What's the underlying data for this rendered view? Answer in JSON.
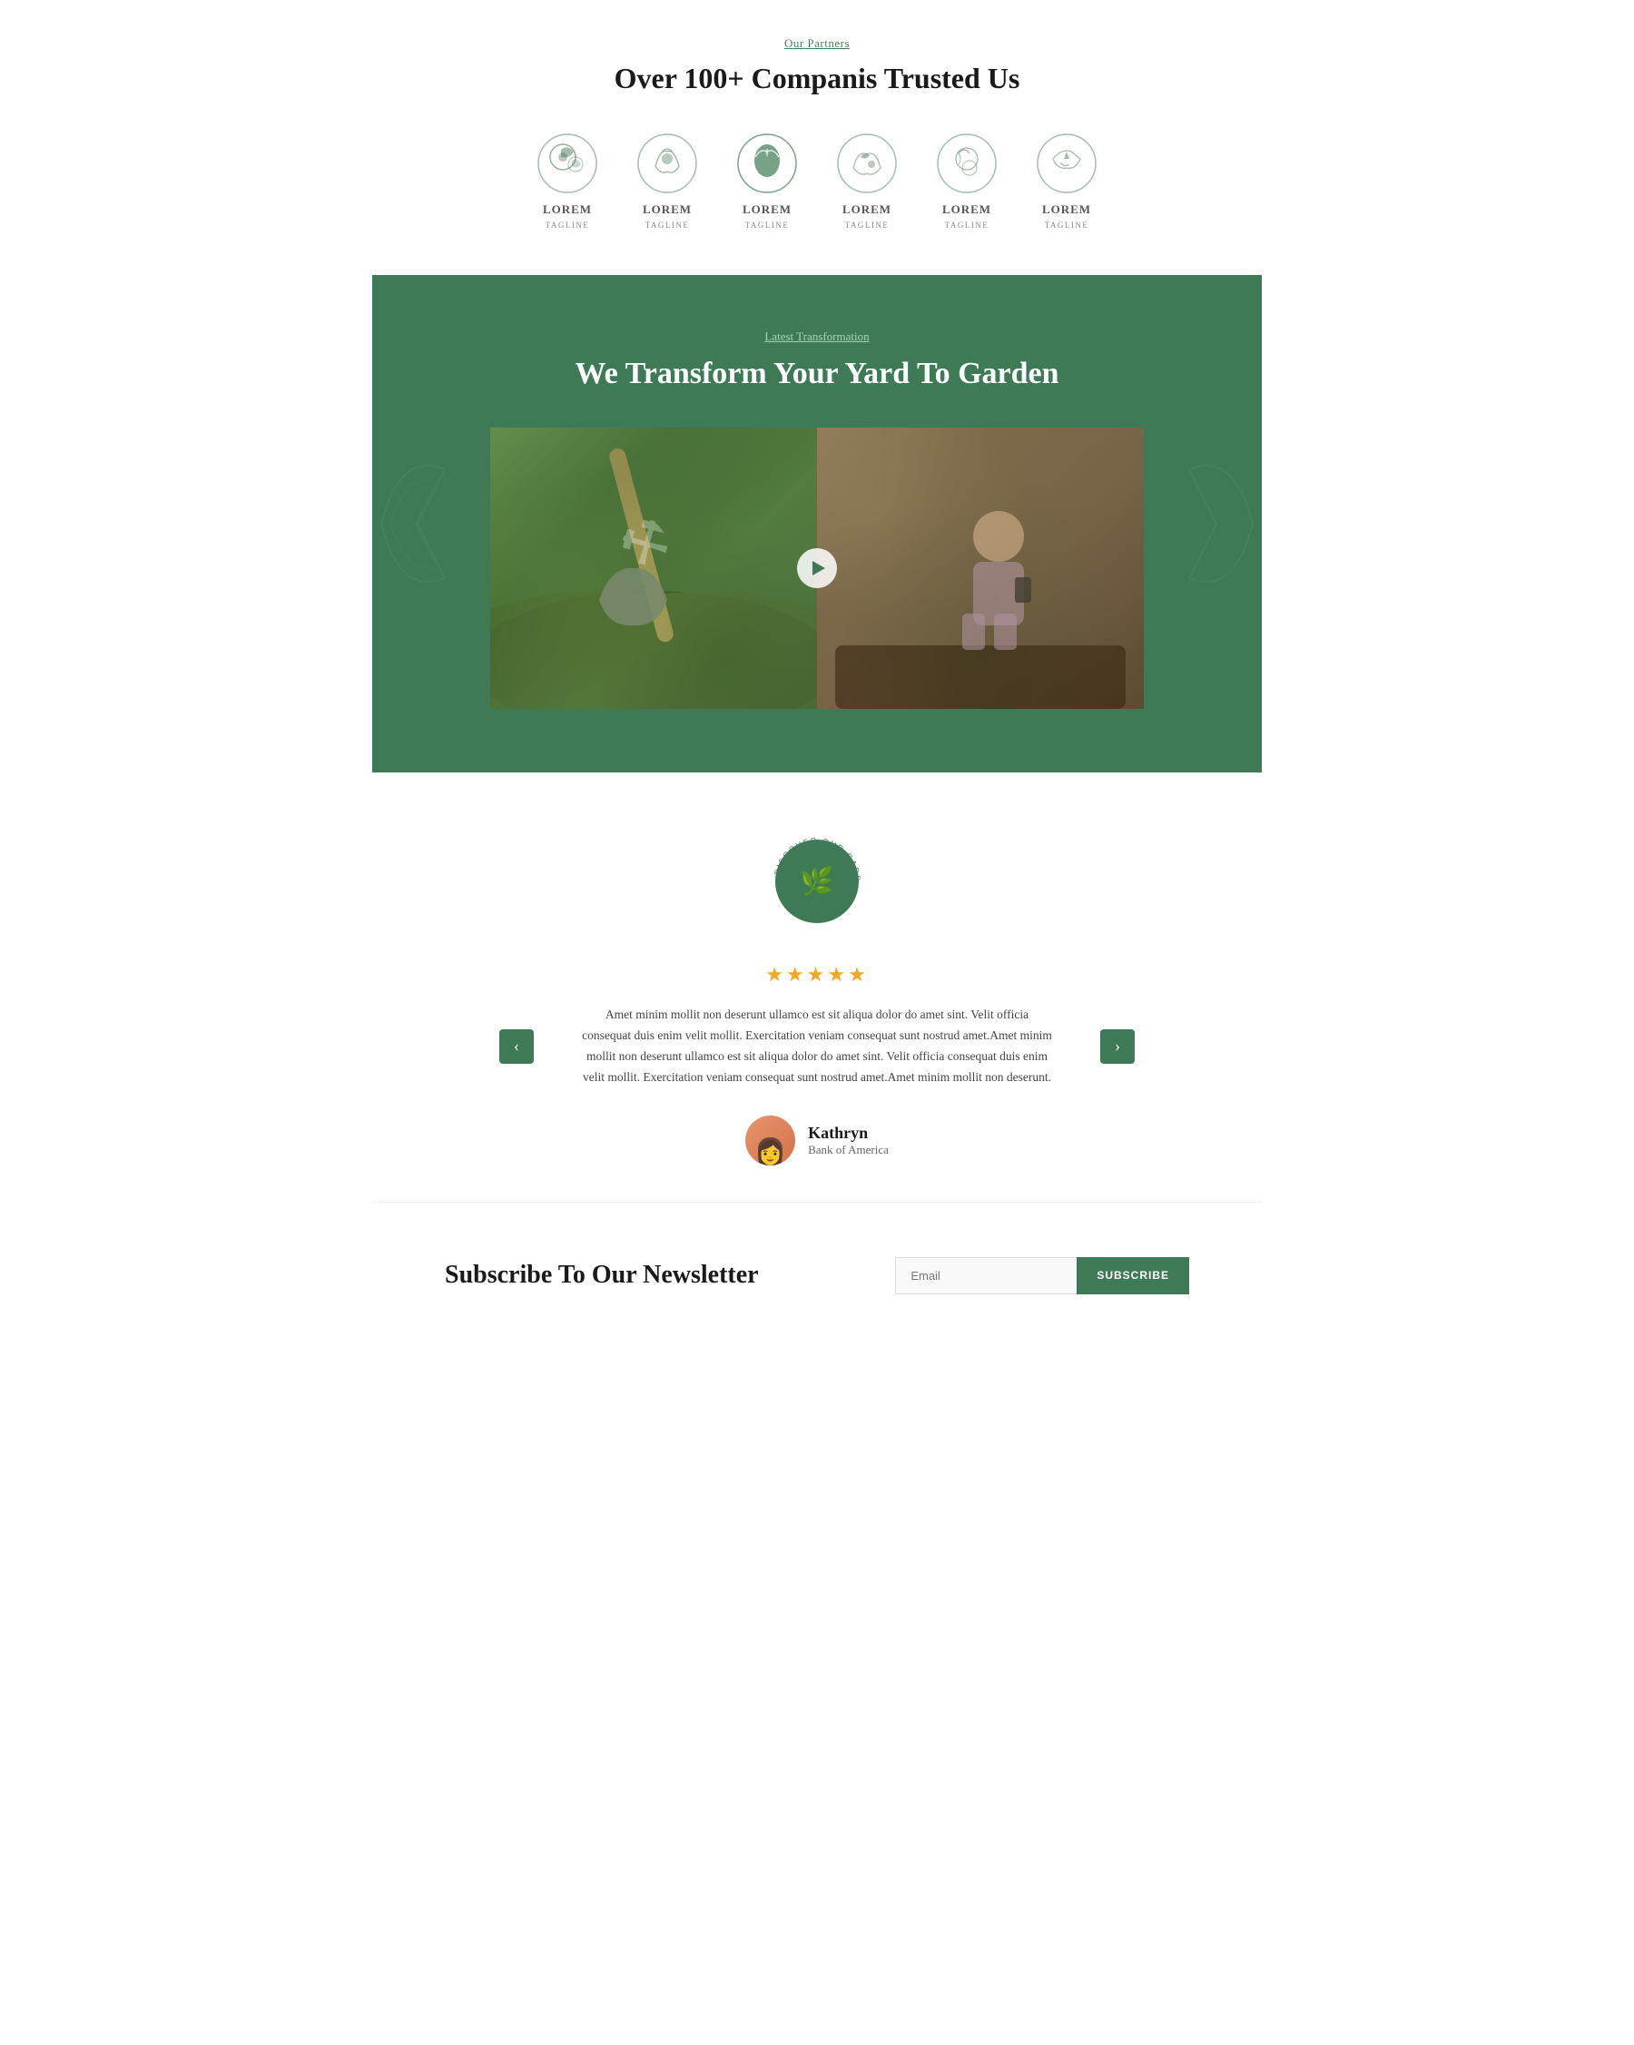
{
  "partners": {
    "label": "Our Partners",
    "title": "Over 100+ Companis Trusted Us",
    "logos": [
      {
        "name": "LOREM",
        "tagline": "TAGLINE"
      },
      {
        "name": "LOREM",
        "tagline": "TAGLINE"
      },
      {
        "name": "LOREM",
        "tagline": "TAGLINE"
      },
      {
        "name": "LOREM",
        "tagline": "TAGLINE"
      },
      {
        "name": "LOREM",
        "tagline": "TAGLINE"
      },
      {
        "name": "LOREM",
        "tagline": "TAGLINE"
      }
    ]
  },
  "transform": {
    "label": "Latest Transformation",
    "title": "We Transform Your Yard To Garden"
  },
  "badge": {
    "outer_text": "DISCOVER OUR GARDEN • EXPLORE & SINCE 1997.",
    "icon": "🌿"
  },
  "testimonial": {
    "stars": "★★★★★",
    "text": "Amet minim mollit non deserunt ullamco est sit aliqua dolor do amet sint. Velit officia consequat duis enim velit mollit. Exercitation veniam consequat sunt nostrud amet.Amet minim mollit non deserunt ullamco est sit aliqua dolor do amet sint. Velit officia consequat duis enim velit mollit. Exercitation veniam consequat sunt nostrud amet.Amet minim mollit non deserunt.",
    "author_name": "Kathryn",
    "author_company": "Bank of America",
    "nav_left": "‹",
    "nav_right": "›"
  },
  "newsletter": {
    "title": "Subscribe To Our Newsletter",
    "email_placeholder": "Email",
    "button_label": "SUBSCRIBE"
  },
  "colors": {
    "green": "#3d7a55",
    "light_green": "#a8d5b5",
    "star_gold": "#f5a623",
    "orange_avatar": "#e8956d"
  }
}
